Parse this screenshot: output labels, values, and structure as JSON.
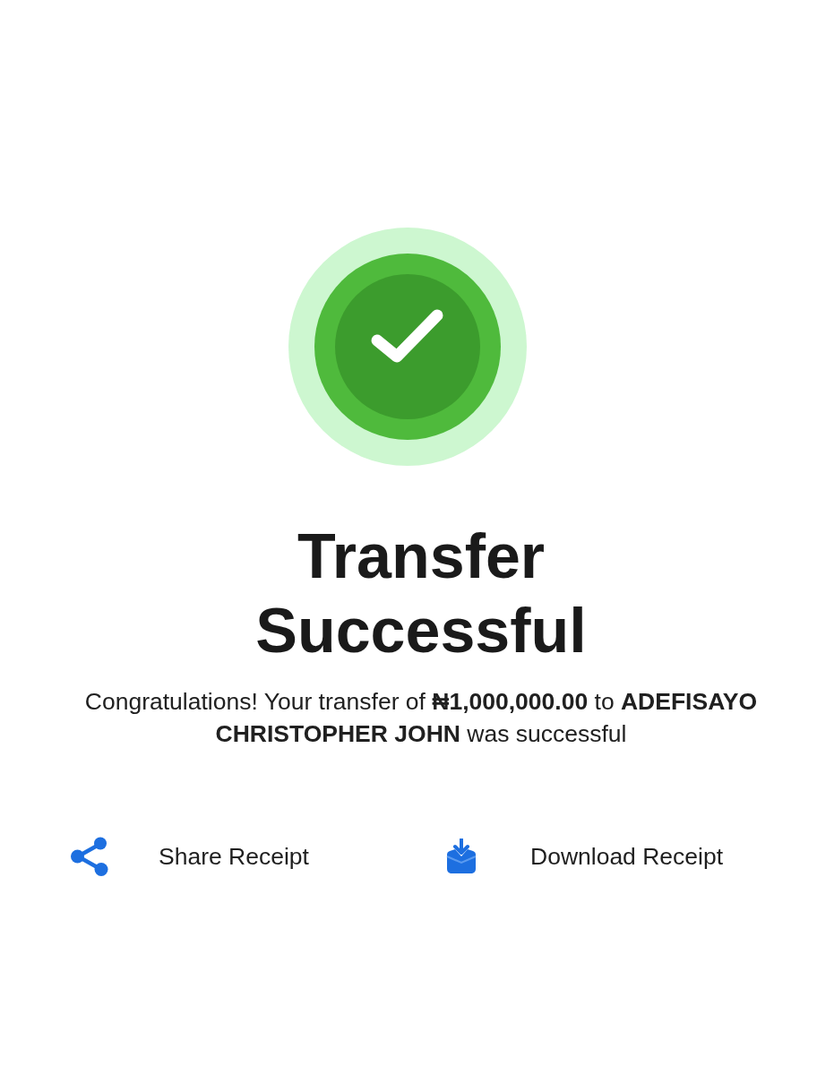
{
  "title": "Transfer Successful",
  "message": "Congratulations! Your transfer of **₦1,000,000.00** to **ADEFISAYO CHRISTOPHER JOHN** was successful",
  "actions": [
    {
      "kind": "share",
      "label": "Share Receipt"
    },
    {
      "kind": "download",
      "label": "Download Receipt"
    }
  ]
}
